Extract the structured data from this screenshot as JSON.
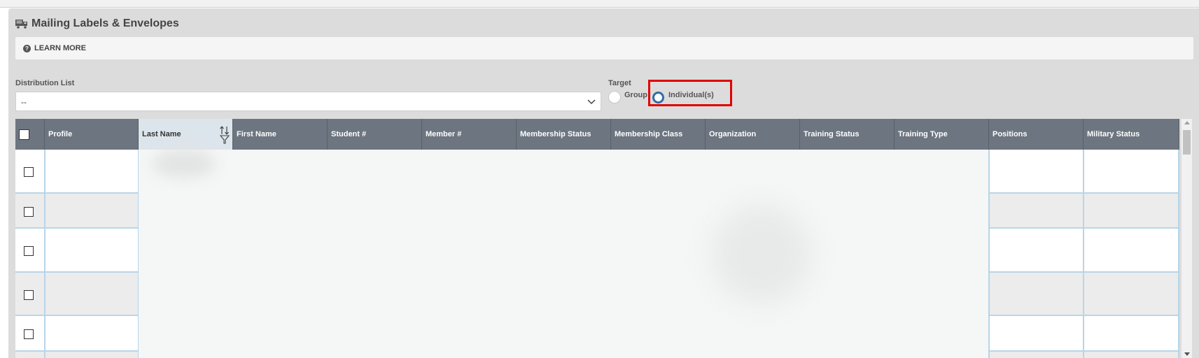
{
  "page": {
    "title": "Mailing Labels & Envelopes",
    "title_icon": "mail-truck-icon",
    "learn_more": "LEARN MORE"
  },
  "form": {
    "distribution_list_label": "Distribution List",
    "distribution_list_value": "--",
    "target_label": "Target",
    "target_options": [
      {
        "label": "Group",
        "selected": false
      },
      {
        "label": "Individual(s)",
        "selected": true
      }
    ]
  },
  "table": {
    "columns": [
      "Profile",
      "Last Name",
      "First Name",
      "Student #",
      "Member #",
      "Membership Status",
      "Membership Class",
      "Organization",
      "Training Status",
      "Training Type",
      "Positions",
      "Military Status"
    ],
    "sorted_column": "Last Name",
    "row_count_visible": 5
  },
  "colors": {
    "header_bg": "#6c7580",
    "sorted_header_bg": "#dde5ec",
    "row_border": "#b7d5e8",
    "highlight": "#e00000",
    "radio_selected": "#2f6ea6"
  }
}
